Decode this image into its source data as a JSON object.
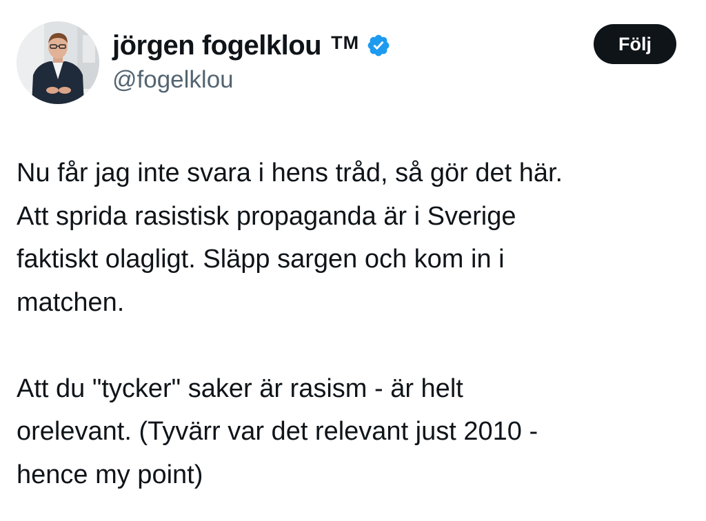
{
  "author": {
    "display_name": "jörgen fogelklou",
    "suffix": "TM",
    "handle": "@fogelklou",
    "verified_badge_icon": "verified-badge-icon",
    "verified_color": "#1d9bf0"
  },
  "follow_button": {
    "label": "Följ"
  },
  "tweet": {
    "paragraphs": [
      {
        "lines": [
          "Nu får jag inte svara i hens tråd, så gör det här.",
          "Att sprida rasistisk propaganda är i Sverige",
          "faktiskt olagligt.  Släpp sargen och kom in i",
          "matchen."
        ]
      },
      {
        "lines": [
          "Att du \"tycker\" saker är rasism - är helt",
          "orelevant. (Tyvärr var det relevant just 2010 -",
          "hence my point)"
        ]
      }
    ]
  }
}
